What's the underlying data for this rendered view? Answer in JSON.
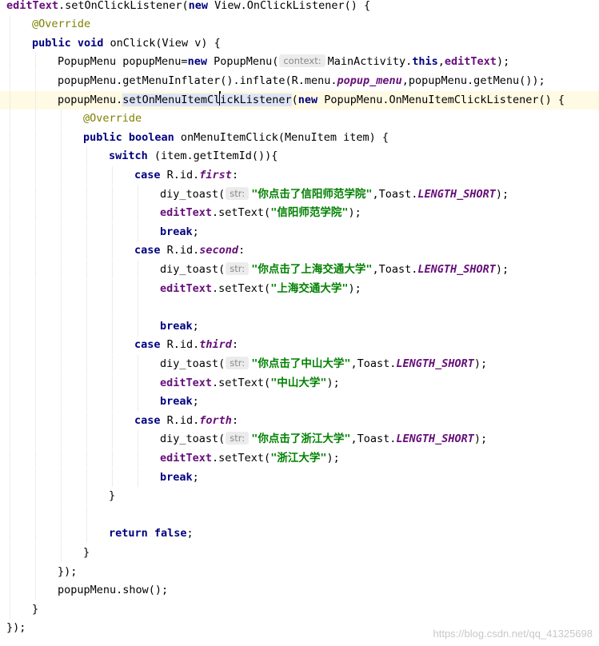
{
  "lines": [
    {
      "indent": 0,
      "tokens": [
        {
          "t": "editText",
          "c": "fld"
        },
        {
          "t": ".setOnClickListener(",
          "c": "pl"
        },
        {
          "t": "new",
          "c": "kw"
        },
        {
          "t": " View.OnClickListener() {",
          "c": "pl"
        }
      ]
    },
    {
      "indent": 1,
      "tokens": [
        {
          "t": "@Override",
          "c": "ann"
        }
      ]
    },
    {
      "indent": 1,
      "tokens": [
        {
          "t": "public void",
          "c": "kw"
        },
        {
          "t": " onClick(View v) {",
          "c": "pl"
        }
      ]
    },
    {
      "indent": 2,
      "tokens": [
        {
          "t": "PopupMenu popupMenu=",
          "c": "pl"
        },
        {
          "t": "new",
          "c": "kw"
        },
        {
          "t": " PopupMenu(",
          "c": "pl"
        },
        {
          "t": "context:",
          "c": "hint"
        },
        {
          "t": "MainActivity.",
          "c": "pl"
        },
        {
          "t": "this",
          "c": "kw"
        },
        {
          "t": ",",
          "c": "pl"
        },
        {
          "t": "editText",
          "c": "fld"
        },
        {
          "t": ");",
          "c": "pl"
        }
      ]
    },
    {
      "indent": 2,
      "tokens": [
        {
          "t": "popupMenu.getMenuInflater().inflate(R.menu.",
          "c": "pl"
        },
        {
          "t": "popup_menu",
          "c": "fldi"
        },
        {
          "t": ",popupMenu.getMenu());",
          "c": "pl"
        }
      ]
    },
    {
      "indent": 2,
      "current": true,
      "tokens": [
        {
          "t": "popupMenu.",
          "c": "pl"
        },
        {
          "t": "setOnMenuItemCl",
          "c": "sel"
        },
        {
          "t": "",
          "c": "caret"
        },
        {
          "t": "ickListener",
          "c": "sel"
        },
        {
          "t": "(",
          "c": "pl"
        },
        {
          "t": "new",
          "c": "kw"
        },
        {
          "t": " PopupMenu.OnMenuItemClickListener() {",
          "c": "pl"
        }
      ]
    },
    {
      "indent": 3,
      "tokens": [
        {
          "t": "@Override",
          "c": "ann"
        }
      ]
    },
    {
      "indent": 3,
      "tokens": [
        {
          "t": "public boolean",
          "c": "kw"
        },
        {
          "t": " onMenuItemClick(MenuItem item) {",
          "c": "pl"
        }
      ]
    },
    {
      "indent": 4,
      "tokens": [
        {
          "t": "switch",
          "c": "kw"
        },
        {
          "t": " (item.getItemId()){",
          "c": "pl"
        }
      ]
    },
    {
      "indent": 5,
      "tokens": [
        {
          "t": "case",
          "c": "kw"
        },
        {
          "t": " R.id.",
          "c": "pl"
        },
        {
          "t": "first",
          "c": "fldi"
        },
        {
          "t": ":",
          "c": "pl"
        }
      ]
    },
    {
      "indent": 6,
      "tokens": [
        {
          "t": "diy_toast(",
          "c": "pl"
        },
        {
          "t": "str:",
          "c": "hint"
        },
        {
          "t": "\"你点击了信阳师范学院\"",
          "c": "str"
        },
        {
          "t": ",Toast.",
          "c": "pl"
        },
        {
          "t": "LENGTH_SHORT",
          "c": "fldi"
        },
        {
          "t": ");",
          "c": "pl"
        }
      ]
    },
    {
      "indent": 6,
      "tokens": [
        {
          "t": "editText",
          "c": "fld"
        },
        {
          "t": ".setText(",
          "c": "pl"
        },
        {
          "t": "\"信阳师范学院\"",
          "c": "str"
        },
        {
          "t": ");",
          "c": "pl"
        }
      ]
    },
    {
      "indent": 6,
      "tokens": [
        {
          "t": "break",
          "c": "kw"
        },
        {
          "t": ";",
          "c": "pl"
        }
      ]
    },
    {
      "indent": 5,
      "tokens": [
        {
          "t": "case",
          "c": "kw"
        },
        {
          "t": " R.id.",
          "c": "pl"
        },
        {
          "t": "second",
          "c": "fldi"
        },
        {
          "t": ":",
          "c": "pl"
        }
      ]
    },
    {
      "indent": 6,
      "tokens": [
        {
          "t": "diy_toast(",
          "c": "pl"
        },
        {
          "t": "str:",
          "c": "hint"
        },
        {
          "t": "\"你点击了上海交通大学\"",
          "c": "str"
        },
        {
          "t": ",Toast.",
          "c": "pl"
        },
        {
          "t": "LENGTH_SHORT",
          "c": "fldi"
        },
        {
          "t": ");",
          "c": "pl"
        }
      ]
    },
    {
      "indent": 6,
      "tokens": [
        {
          "t": "editText",
          "c": "fld"
        },
        {
          "t": ".setText(",
          "c": "pl"
        },
        {
          "t": "\"上海交通大学\"",
          "c": "str"
        },
        {
          "t": ");",
          "c": "pl"
        }
      ]
    },
    {
      "indent": 6,
      "tokens": []
    },
    {
      "indent": 6,
      "tokens": [
        {
          "t": "break",
          "c": "kw"
        },
        {
          "t": ";",
          "c": "pl"
        }
      ]
    },
    {
      "indent": 5,
      "tokens": [
        {
          "t": "case",
          "c": "kw"
        },
        {
          "t": " R.id.",
          "c": "pl"
        },
        {
          "t": "third",
          "c": "fldi"
        },
        {
          "t": ":",
          "c": "pl"
        }
      ]
    },
    {
      "indent": 6,
      "tokens": [
        {
          "t": "diy_toast(",
          "c": "pl"
        },
        {
          "t": "str:",
          "c": "hint"
        },
        {
          "t": "\"你点击了中山大学\"",
          "c": "str"
        },
        {
          "t": ",Toast.",
          "c": "pl"
        },
        {
          "t": "LENGTH_SHORT",
          "c": "fldi"
        },
        {
          "t": ");",
          "c": "pl"
        }
      ]
    },
    {
      "indent": 6,
      "tokens": [
        {
          "t": "editText",
          "c": "fld"
        },
        {
          "t": ".setText(",
          "c": "pl"
        },
        {
          "t": "\"中山大学\"",
          "c": "str"
        },
        {
          "t": ");",
          "c": "pl"
        }
      ]
    },
    {
      "indent": 6,
      "tokens": [
        {
          "t": "break",
          "c": "kw"
        },
        {
          "t": ";",
          "c": "pl"
        }
      ]
    },
    {
      "indent": 5,
      "tokens": [
        {
          "t": "case",
          "c": "kw"
        },
        {
          "t": " R.id.",
          "c": "pl"
        },
        {
          "t": "forth",
          "c": "fldi"
        },
        {
          "t": ":",
          "c": "pl"
        }
      ]
    },
    {
      "indent": 6,
      "tokens": [
        {
          "t": "diy_toast(",
          "c": "pl"
        },
        {
          "t": "str:",
          "c": "hint"
        },
        {
          "t": "\"你点击了浙江大学\"",
          "c": "str"
        },
        {
          "t": ",Toast.",
          "c": "pl"
        },
        {
          "t": "LENGTH_SHORT",
          "c": "fldi"
        },
        {
          "t": ");",
          "c": "pl"
        }
      ]
    },
    {
      "indent": 6,
      "tokens": [
        {
          "t": "editText",
          "c": "fld"
        },
        {
          "t": ".setText(",
          "c": "pl"
        },
        {
          "t": "\"浙江大学\"",
          "c": "str"
        },
        {
          "t": ");",
          "c": "pl"
        }
      ]
    },
    {
      "indent": 6,
      "tokens": [
        {
          "t": "break",
          "c": "kw"
        },
        {
          "t": ";",
          "c": "pl"
        }
      ]
    },
    {
      "indent": 4,
      "tokens": [
        {
          "t": "}",
          "c": "pl"
        }
      ]
    },
    {
      "indent": 4,
      "tokens": []
    },
    {
      "indent": 4,
      "tokens": [
        {
          "t": "return false",
          "c": "kw"
        },
        {
          "t": ";",
          "c": "pl"
        }
      ]
    },
    {
      "indent": 3,
      "tokens": [
        {
          "t": "}",
          "c": "pl"
        }
      ]
    },
    {
      "indent": 2,
      "tokens": [
        {
          "t": "});",
          "c": "pl"
        }
      ]
    },
    {
      "indent": 2,
      "tokens": [
        {
          "t": "popupMenu.show();",
          "c": "pl"
        }
      ]
    },
    {
      "indent": 1,
      "tokens": [
        {
          "t": "}",
          "c": "pl"
        }
      ]
    },
    {
      "indent": 0,
      "tokens": [
        {
          "t": "});",
          "c": "pl"
        }
      ]
    }
  ],
  "watermark": "https://blog.csdn.net/qq_41325698",
  "colors": {
    "keyword": "#000080",
    "field": "#660e7a",
    "string": "#008000",
    "annotation": "#808000",
    "current_line": "#fffae3",
    "selection": "#dfe4f7"
  }
}
